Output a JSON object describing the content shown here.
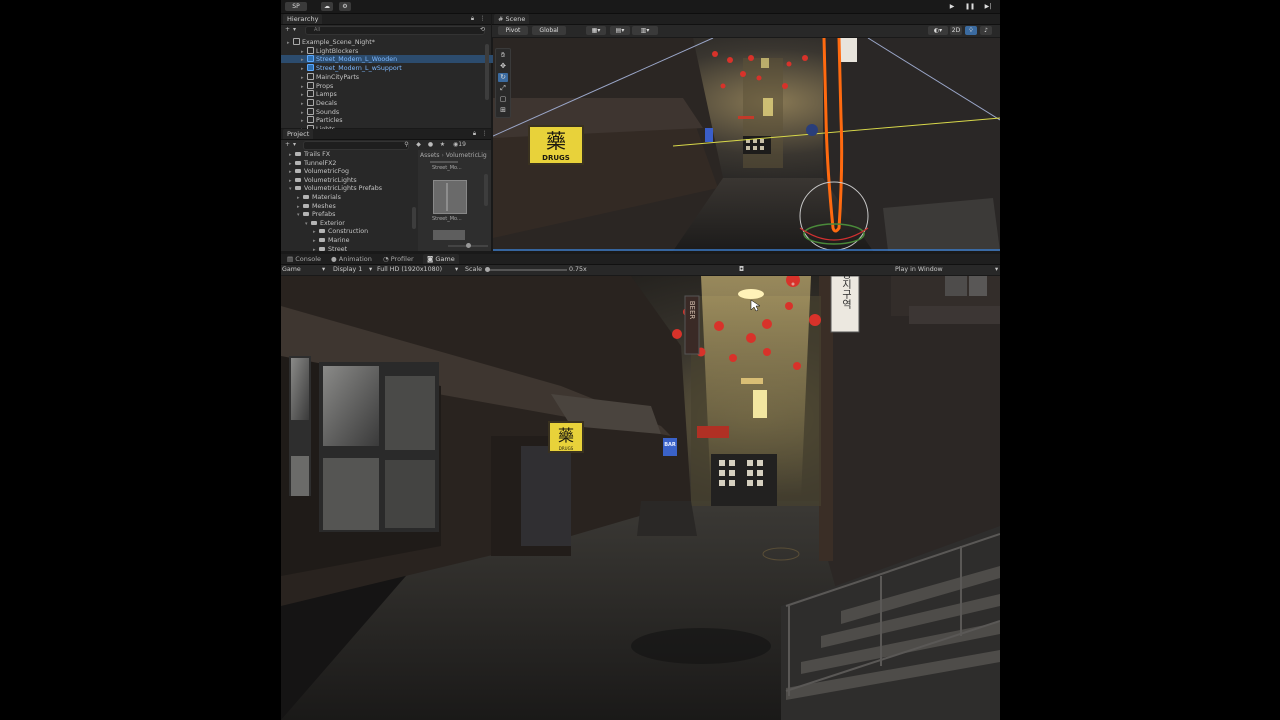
{
  "toolbar": {
    "account": "SP",
    "play_icon": "play-icon",
    "pause_icon": "pause-icon",
    "step_icon": "step-icon"
  },
  "hierarchy": {
    "tab": "Hierarchy",
    "search_placeholder": "All",
    "items": [
      {
        "label": "Example_Scene_Night*",
        "selected": false
      },
      {
        "label": "LightBlockers",
        "selected": false
      },
      {
        "label": "Street_Modern_L_Wooden",
        "selected": true
      },
      {
        "label": "Street_Modern_L_wSupport",
        "selected": false
      },
      {
        "label": "MainCityParts",
        "selected": false
      },
      {
        "label": "Props",
        "selected": false
      },
      {
        "label": "Lamps",
        "selected": false
      },
      {
        "label": "Decals",
        "selected": false
      },
      {
        "label": "Sounds",
        "selected": false
      },
      {
        "label": "Particles",
        "selected": false
      },
      {
        "label": "Lights",
        "selected": false
      }
    ]
  },
  "project": {
    "tab": "Project",
    "count": "19",
    "breadcrumb": [
      "Assets",
      "VolumetricLig"
    ],
    "folders": [
      "Trails FX",
      "TunnelFX2",
      "VolumetricFog",
      "VolumetricLights",
      "VolumetricLights Prefabs",
      "Materials",
      "Meshes",
      "Prefabs",
      "Exterior",
      "Construction",
      "Marine",
      "Street"
    ],
    "assets": [
      "Street_Mo...",
      "Street_Mo..."
    ]
  },
  "scene": {
    "tab": "Scene",
    "pivot": "Pivot",
    "global": "Global",
    "mode_2d": "2D"
  },
  "bottom_tabs": [
    "Console",
    "Animation",
    "Profiler",
    "Game"
  ],
  "game": {
    "view": "Game",
    "display": "Display 1",
    "resolution": "Full HD (1920x1080)",
    "scale_label": "Scale",
    "scale_value": "0.75x",
    "play_mode": "Play in Window"
  },
  "signs": {
    "drugs_glyph": "藥",
    "drugs_text": "DRUGS",
    "korean": "승지구역",
    "bar": "BAR",
    "beer": "BEER"
  },
  "colors": {
    "panel": "#282828",
    "selection": "#2c4c6e",
    "accent": "#5aa8ff",
    "sign_yellow": "#e8d23a",
    "lantern": "#d8322a"
  }
}
